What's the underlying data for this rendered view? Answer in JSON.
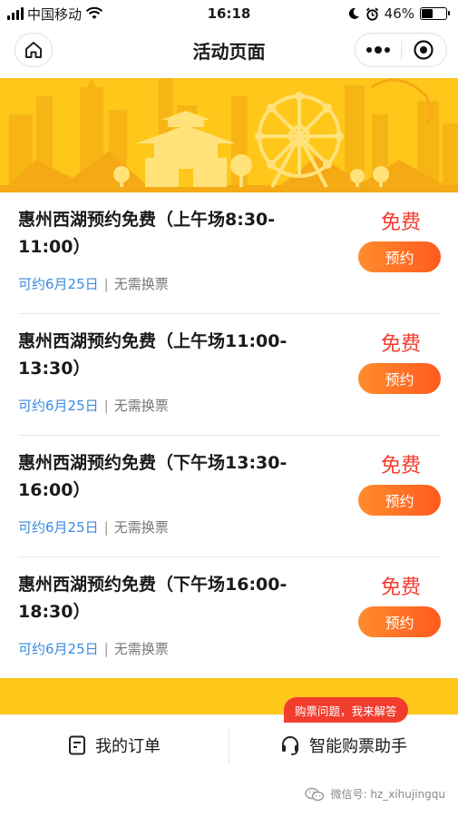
{
  "status_bar": {
    "carrier": "中国移动",
    "time": "16:18",
    "battery": "46%"
  },
  "nav": {
    "title": "活动页面"
  },
  "items": [
    {
      "title": "惠州西湖预约免费（上午场8:30-11:00）",
      "price": "免费",
      "book_label": "预约",
      "avail": "可约6月25日",
      "sep": "|",
      "note": "无需换票"
    },
    {
      "title": "惠州西湖预约免费（上午场11:00-13:30）",
      "price": "免费",
      "book_label": "预约",
      "avail": "可约6月25日",
      "sep": "|",
      "note": "无需换票"
    },
    {
      "title": "惠州西湖预约免费（下午场13:30-16:00）",
      "price": "免费",
      "book_label": "预约",
      "avail": "可约6月25日",
      "sep": "|",
      "note": "无需换票"
    },
    {
      "title": "惠州西湖预约免费（下午场16:00-18:30）",
      "price": "免费",
      "book_label": "预约",
      "avail": "可约6月25日",
      "sep": "|",
      "note": "无需换票"
    }
  ],
  "tabbar": {
    "orders_label": "我的订单",
    "assistant_label": "智能购票助手",
    "tooltip": "购票问题，我来解答"
  },
  "watermark": {
    "text": "微信号: hz_xihujingqu"
  },
  "colors": {
    "accent_yellow": "#fec71a",
    "price_red": "#f23c2e",
    "button_orange": "#ff7a26",
    "link_blue": "#3b8be0"
  },
  "icons": [
    "home-icon",
    "wifi-icon",
    "moon-icon",
    "alarm-icon",
    "more-dots-icon",
    "target-icon",
    "order-list-icon",
    "headset-icon",
    "wechat-icon"
  ]
}
